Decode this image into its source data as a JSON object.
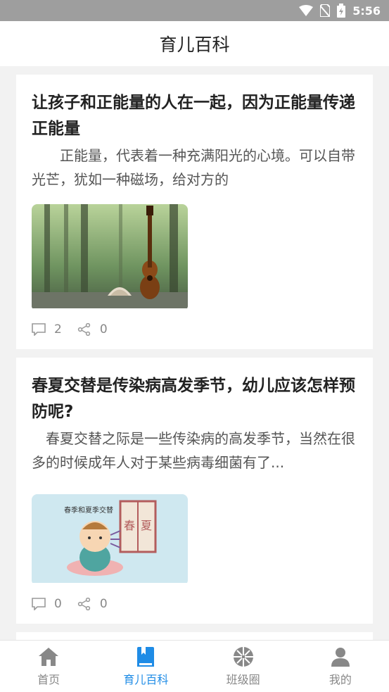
{
  "status_bar": {
    "time": "5:56",
    "icons": [
      "wifi-icon",
      "no-sim-icon",
      "battery-charging-icon"
    ]
  },
  "header": {
    "title": "育儿百科"
  },
  "articles": [
    {
      "title": "让孩子和正能量的人在一起，因为正能量传递正能量",
      "excerpt": "正能量，代表着一种充满阳光的心境。可以自带光芒，犹如一种磁场，给对方的",
      "image": "guitar-and-book-in-forest",
      "comments": "2",
      "shares": "0"
    },
    {
      "title": "春夏交替是传染病高发季节，幼儿应该怎样预防呢?",
      "excerpt": "春夏交替之际是一些传染病的高发季节，当然在很多的时候成年人对于某些病毒细菌有了...",
      "image": "baby-sneezing-illustration",
      "image_text": {
        "banner": "春季和夏季交替",
        "left_char": "春",
        "right_char": "夏"
      },
      "comments": "0",
      "shares": "0"
    }
  ],
  "bottom_nav": {
    "items": [
      {
        "label": "首页",
        "icon": "home-icon",
        "active": false
      },
      {
        "label": "育儿百科",
        "icon": "book-icon",
        "active": true
      },
      {
        "label": "班级圈",
        "icon": "aperture-icon",
        "active": false
      },
      {
        "label": "我的",
        "icon": "user-icon",
        "active": false
      }
    ],
    "active_color": "#1f8ce6",
    "inactive_color": "#888888"
  }
}
